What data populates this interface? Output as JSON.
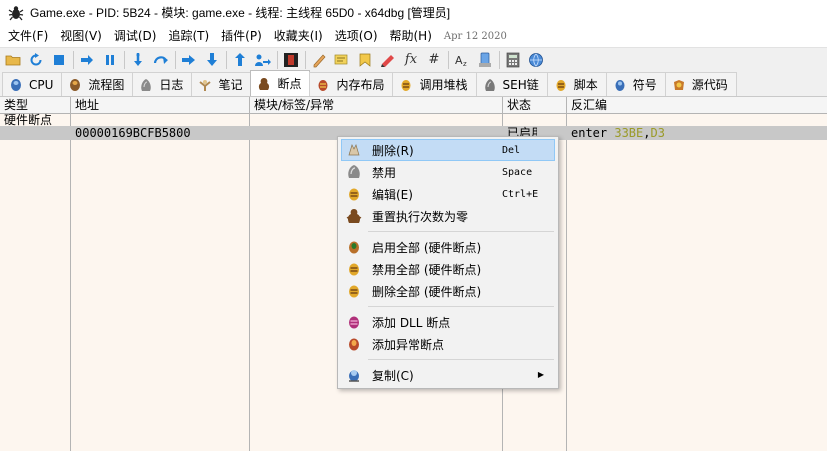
{
  "window": {
    "title": "Game.exe - PID: 5B24 - 模块: game.exe - 线程: 主线程 65D0 - x64dbg [管理员]",
    "icon": "bug-icon"
  },
  "menu": {
    "items": [
      "文件(F)",
      "视图(V)",
      "调试(D)",
      "追踪(T)",
      "插件(P)",
      "收藏夹(I)",
      "选项(O)",
      "帮助(H)"
    ],
    "date": "Apr 12 2020"
  },
  "toolbar": {
    "buttons": [
      "open",
      "restart",
      "stop",
      "run",
      "pause",
      "step-into",
      "step-over",
      "trace-into",
      "trace-over",
      "execute-till-return",
      "run-to-user-code",
      "patches",
      "comments",
      "labels",
      "bookmarks",
      "functions",
      "font",
      "calculator",
      "attach",
      "strings",
      "scylla",
      "about"
    ],
    "fx_label": "fx",
    "hash_label": "#"
  },
  "tabs": [
    {
      "label": "CPU",
      "icon": "cpu-icon",
      "active": false
    },
    {
      "label": "流程图",
      "icon": "graph-icon",
      "active": false
    },
    {
      "label": "日志",
      "icon": "log-icon",
      "active": false
    },
    {
      "label": "笔记",
      "icon": "notes-icon",
      "active": false
    },
    {
      "label": "断点",
      "icon": "breakpoint-icon",
      "active": true
    },
    {
      "label": "内存布局",
      "icon": "memory-icon",
      "active": false
    },
    {
      "label": "调用堆栈",
      "icon": "callstack-icon",
      "active": false
    },
    {
      "label": "SEH链",
      "icon": "seh-icon",
      "active": false
    },
    {
      "label": "脚本",
      "icon": "script-icon",
      "active": false
    },
    {
      "label": "符号",
      "icon": "symbol-icon",
      "active": false
    },
    {
      "label": "源代码",
      "icon": "source-icon",
      "active": false
    }
  ],
  "table": {
    "columns": [
      "类型",
      "地址",
      "模块/标签/异常",
      "状态",
      "反汇编"
    ],
    "group_label": "硬件断点",
    "rows": [
      {
        "address": "00000169BCFB5800",
        "module": "",
        "status": "已启用",
        "disasm_op": "enter",
        "disasm_args": "33BE,D3",
        "disasm_comma": ","
      }
    ]
  },
  "context_menu": {
    "items": [
      {
        "label": "删除(R)",
        "shortcut": "Del",
        "icon": "trash-icon"
      },
      {
        "label": "禁用",
        "shortcut": "Space",
        "icon": "disable-icon"
      },
      {
        "label": "编辑(E)",
        "shortcut": "Ctrl+E",
        "icon": "edit-icon"
      },
      {
        "label": "重置执行次数为零",
        "shortcut": "",
        "icon": "reset-icon"
      },
      {
        "label": "启用全部 (硬件断点)",
        "shortcut": "",
        "icon": "enable-all-icon"
      },
      {
        "label": "禁用全部 (硬件断点)",
        "shortcut": "",
        "icon": "disable-all-icon"
      },
      {
        "label": "删除全部 (硬件断点)",
        "shortcut": "",
        "icon": "remove-all-icon"
      },
      {
        "label": "添加 DLL 断点",
        "shortcut": "",
        "icon": "dll-icon"
      },
      {
        "label": "添加异常断点",
        "shortcut": "",
        "icon": "exception-icon"
      },
      {
        "label": "复制(C)",
        "shortcut": "",
        "icon": "copy-icon"
      }
    ]
  },
  "colors": {
    "selection": "#c8c8c8",
    "menu_hover": "#c3dcf5",
    "asm_number": "#9a9a28",
    "background": "#fdf6ef"
  }
}
